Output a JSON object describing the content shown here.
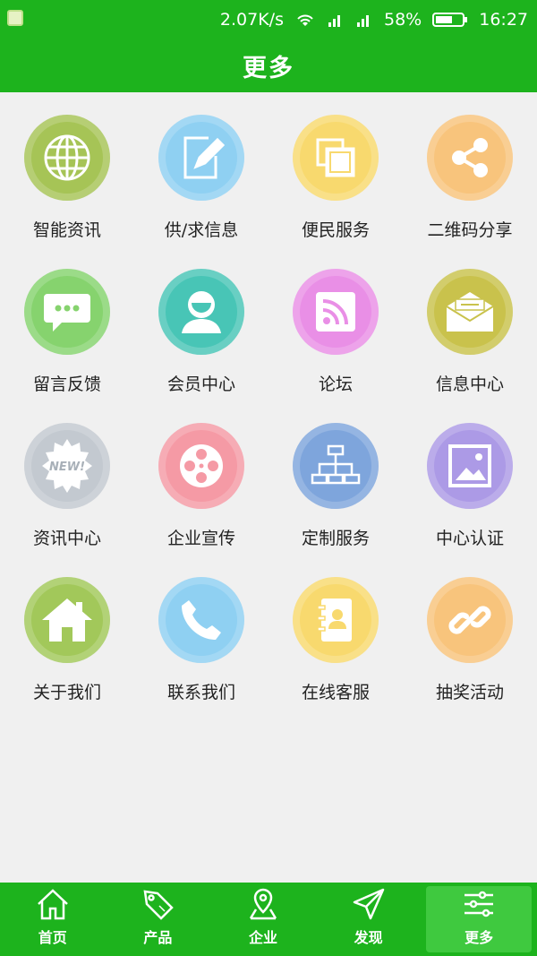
{
  "status": {
    "speed": "2.07K/s",
    "battery": "58%",
    "time": "16:27"
  },
  "title": "更多",
  "grid": [
    {
      "label": "智能资讯",
      "color": "#a6c456",
      "icon": "globe-icon"
    },
    {
      "label": "供/求信息",
      "color": "#8fd0f2",
      "icon": "edit-icon"
    },
    {
      "label": "便民服务",
      "color": "#f8d96e",
      "icon": "copy-icon"
    },
    {
      "label": "二维码分享",
      "color": "#f8c47c",
      "icon": "share-icon"
    },
    {
      "label": "留言反馈",
      "color": "#86d36e",
      "icon": "chat-icon"
    },
    {
      "label": "会员中心",
      "color": "#48c5b6",
      "icon": "user-icon"
    },
    {
      "label": "论坛",
      "color": "#e98fe6",
      "icon": "rss-icon"
    },
    {
      "label": "信息中心",
      "color": "#c9c24c",
      "icon": "envelope-icon"
    },
    {
      "label": "资讯中心",
      "color": "#c3c9d0",
      "icon": "new-badge-icon"
    },
    {
      "label": "企业宣传",
      "color": "#f59aa5",
      "icon": "film-reel-icon"
    },
    {
      "label": "定制服务",
      "color": "#7ea5dc",
      "icon": "org-chart-icon"
    },
    {
      "label": "中心认证",
      "color": "#ac9ae6",
      "icon": "picture-icon"
    },
    {
      "label": "关于我们",
      "color": "#a2c85a",
      "icon": "home-icon"
    },
    {
      "label": "联系我们",
      "color": "#8fd0f2",
      "icon": "phone-icon"
    },
    {
      "label": "在线客服",
      "color": "#f8d96e",
      "icon": "contacts-book-icon"
    },
    {
      "label": "抽奖活动",
      "color": "#f8c47c",
      "icon": "link-icon"
    }
  ],
  "tabs": [
    {
      "label": "首页",
      "icon": "home-outline-icon"
    },
    {
      "label": "产品",
      "icon": "tag-icon"
    },
    {
      "label": "企业",
      "icon": "map-pin-icon"
    },
    {
      "label": "发现",
      "icon": "send-icon"
    },
    {
      "label": "更多",
      "icon": "sliders-icon",
      "active": true
    }
  ],
  "colors": {
    "brand": "#1db31d",
    "background": "#f0f0f0"
  }
}
